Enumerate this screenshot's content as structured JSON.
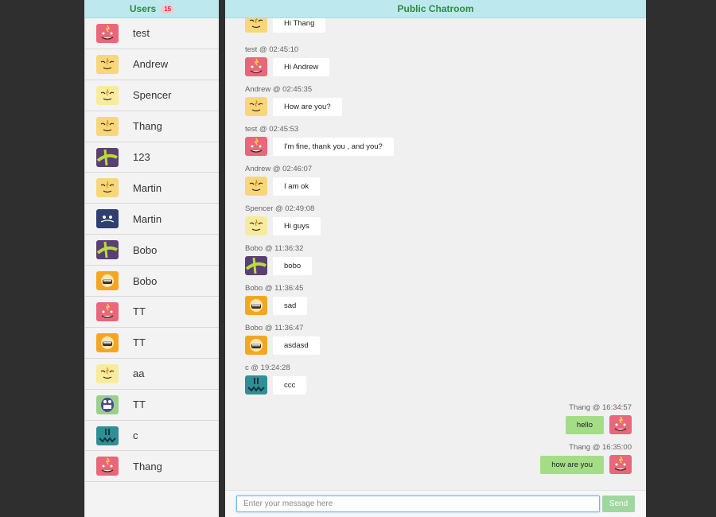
{
  "sidebar": {
    "title": "Users",
    "count": "15",
    "users": [
      {
        "name": "test",
        "avatar": "pink"
      },
      {
        "name": "Andrew",
        "avatar": "yellow"
      },
      {
        "name": "Spencer",
        "avatar": "paleyellow"
      },
      {
        "name": "Thang",
        "avatar": "yellow"
      },
      {
        "name": "123",
        "avatar": "purple"
      },
      {
        "name": "Martin",
        "avatar": "yellow"
      },
      {
        "name": "Martin",
        "avatar": "navy"
      },
      {
        "name": "Bobo",
        "avatar": "purple"
      },
      {
        "name": "Bobo",
        "avatar": "orange"
      },
      {
        "name": "TT",
        "avatar": "pink"
      },
      {
        "name": "TT",
        "avatar": "orange"
      },
      {
        "name": "aa",
        "avatar": "paleyellow"
      },
      {
        "name": "TT",
        "avatar": "green"
      },
      {
        "name": "c",
        "avatar": "teal"
      },
      {
        "name": "Thang",
        "avatar": "pink"
      }
    ]
  },
  "chat": {
    "title": "Public Chatroom",
    "messages": [
      {
        "meta": "",
        "text": "Hi Thang",
        "avatar": "yellow",
        "mine": false
      },
      {
        "meta": "test @ 02:45:10",
        "text": "Hi Andrew",
        "avatar": "pink",
        "mine": false
      },
      {
        "meta": "Andrew @ 02:45:35",
        "text": "How are you?",
        "avatar": "yellow",
        "mine": false
      },
      {
        "meta": "test @ 02:45:53",
        "text": "I'm fine, thank you , and you?",
        "avatar": "pink",
        "mine": false
      },
      {
        "meta": "Andrew @ 02:46:07",
        "text": "I am ok",
        "avatar": "yellow",
        "mine": false
      },
      {
        "meta": "Spencer @ 02:49:08",
        "text": "Hi guys",
        "avatar": "paleyellow",
        "mine": false
      },
      {
        "meta": "Bobo @ 11:36:32",
        "text": "bobo",
        "avatar": "purple",
        "mine": false
      },
      {
        "meta": "Bobo @ 11:36:45",
        "text": "sad",
        "avatar": "orange",
        "mine": false
      },
      {
        "meta": "Bobo @ 11:36:47",
        "text": "asdasd",
        "avatar": "orange",
        "mine": false
      },
      {
        "meta": "c @ 19:24:28",
        "text": "ccc",
        "avatar": "teal",
        "mine": false
      },
      {
        "meta": "Thang @ 16:34:57",
        "text": "hello",
        "avatar": "pink",
        "mine": true
      },
      {
        "meta": "Thang @ 16:35:00",
        "text": "how are you",
        "avatar": "pink",
        "mine": true
      }
    ]
  },
  "composer": {
    "placeholder": "Enter your message here",
    "send_label": "Send"
  },
  "colors": {
    "header_bg": "#bce8ee",
    "title_green": "#2e8b3a",
    "mine_bubble": "#a4dd86",
    "send_button": "#9fd79f",
    "avatar_pink": "#e8677a",
    "avatar_yellow": "#f7d77a",
    "avatar_paleyellow": "#f8ec9c",
    "avatar_purple": "#5a3f73",
    "avatar_navy": "#2f3f6e",
    "avatar_orange": "#f4a623",
    "avatar_green": "#9ccf8c",
    "avatar_teal": "#2f8f97"
  }
}
